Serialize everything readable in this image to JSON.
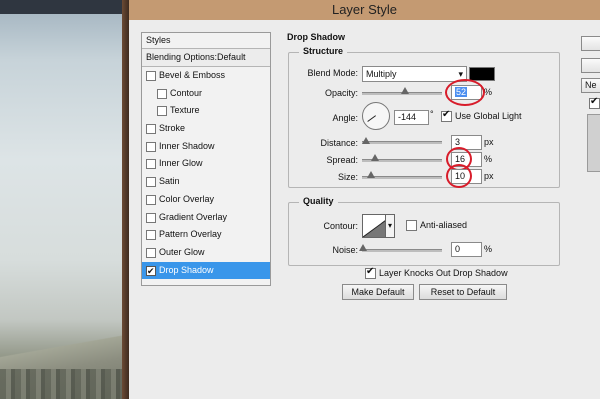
{
  "dialog": {
    "title": "Layer Style"
  },
  "styles_panel": {
    "header": "Styles",
    "blending_options": "Blending Options:Default",
    "items": [
      {
        "label": "Bevel & Emboss",
        "checked": false,
        "indent": false,
        "selected": false
      },
      {
        "label": "Contour",
        "checked": false,
        "indent": true,
        "selected": false
      },
      {
        "label": "Texture",
        "checked": false,
        "indent": true,
        "selected": false
      },
      {
        "label": "Stroke",
        "checked": false,
        "indent": false,
        "selected": false
      },
      {
        "label": "Inner Shadow",
        "checked": false,
        "indent": false,
        "selected": false
      },
      {
        "label": "Inner Glow",
        "checked": false,
        "indent": false,
        "selected": false
      },
      {
        "label": "Satin",
        "checked": false,
        "indent": false,
        "selected": false
      },
      {
        "label": "Color Overlay",
        "checked": false,
        "indent": false,
        "selected": false
      },
      {
        "label": "Gradient Overlay",
        "checked": false,
        "indent": false,
        "selected": false
      },
      {
        "label": "Pattern Overlay",
        "checked": false,
        "indent": false,
        "selected": false
      },
      {
        "label": "Outer Glow",
        "checked": false,
        "indent": false,
        "selected": false
      },
      {
        "label": "Drop Shadow",
        "checked": true,
        "indent": false,
        "selected": true
      }
    ]
  },
  "drop_shadow": {
    "section_title": "Drop Shadow",
    "structure": {
      "group_label": "Structure",
      "blend_mode_label": "Blend Mode:",
      "blend_mode_value": "Multiply",
      "shadow_color": "#000000",
      "opacity_label": "Opacity:",
      "opacity_value": "52",
      "opacity_unit": "%",
      "angle_label": "Angle:",
      "angle_value": "-144",
      "angle_unit": "°",
      "use_global_light_label": "Use Global Light",
      "use_global_light_checked": true,
      "distance_label": "Distance:",
      "distance_value": "3",
      "distance_unit": "px",
      "spread_label": "Spread:",
      "spread_value": "16",
      "spread_unit": "%",
      "size_label": "Size:",
      "size_value": "10",
      "size_unit": "px"
    },
    "quality": {
      "group_label": "Quality",
      "contour_label": "Contour:",
      "anti_aliased_label": "Anti-aliased",
      "anti_aliased_checked": false,
      "noise_label": "Noise:",
      "noise_value": "0",
      "noise_unit": "%"
    },
    "knocks_out_label": "Layer Knocks Out Drop Shadow",
    "knocks_out_checked": true,
    "make_default_label": "Make Default",
    "reset_default_label": "Reset to Default"
  },
  "right_edge": {
    "partial_button_label": "Ne"
  },
  "annotation_color": "#d81c2a",
  "selection_color": "#3996ea"
}
